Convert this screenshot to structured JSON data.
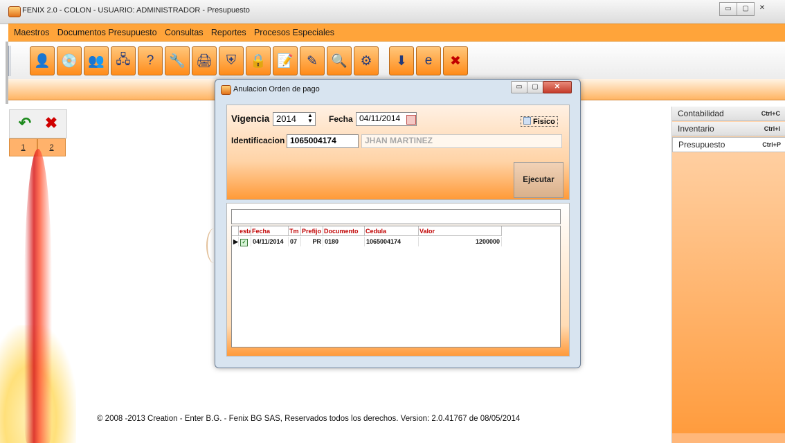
{
  "window": {
    "title": "FENIX 2.0 -  COLON - USUARIO: ADMINISTRADOR  - Presupuesto",
    "minimize": "▭",
    "maximize": "▢",
    "close": "✕"
  },
  "menu": {
    "items": [
      "Maestros",
      "Documentos Presupuesto",
      "Consultas",
      "Reportes",
      "Procesos Especiales"
    ]
  },
  "toolbar": {
    "icons": [
      "user-icon",
      "disk-icon",
      "users-icon",
      "network-icon",
      "help-icon",
      "tools-icon",
      "printer-icon",
      "shield-icon",
      "lock-icon",
      "notepad-icon",
      "checklist-icon",
      "search-icon",
      "settings-icon",
      "download-icon",
      "ie-icon",
      "exit-icon"
    ]
  },
  "left_tools": {
    "tabs": [
      "1",
      "2"
    ]
  },
  "right_panel": {
    "items": [
      {
        "label": "Contabilidad",
        "shortcut": "Ctrl+C"
      },
      {
        "label": "Inventario",
        "shortcut": "Ctrl+I"
      },
      {
        "label": "Presupuesto",
        "shortcut": "Ctrl+P"
      }
    ]
  },
  "footer": {
    "copyright": "© 2008 -2013 Creation - Enter B.G. - Fenix BG SAS, Reservados todos los derechos.    Version: 2.0.41767 de 08/05/2014"
  },
  "dialog": {
    "title": "Anulacion Orden de pago",
    "vigencia_label": "Vigencia",
    "vigencia_value": "2014",
    "fecha_label": "Fecha",
    "fecha_value": "04/11/2014",
    "fisico_label": "Fisico",
    "identificacion_label": "Identificacion",
    "identificacion_value": "1065004174",
    "nombre_value": "JHAN MARTINEZ",
    "ejecutar_label": "Ejecutar",
    "grid": {
      "headers": [
        "esta",
        "Fecha",
        "Tm",
        "Prefijo",
        "Documento",
        "Cedula",
        "Valor"
      ],
      "rows": [
        {
          "fecha": "04/11/2014",
          "tm": "07",
          "prefijo": "PR",
          "documento": "0180",
          "cedula": "1065004174",
          "valor": "1200000"
        }
      ]
    }
  }
}
